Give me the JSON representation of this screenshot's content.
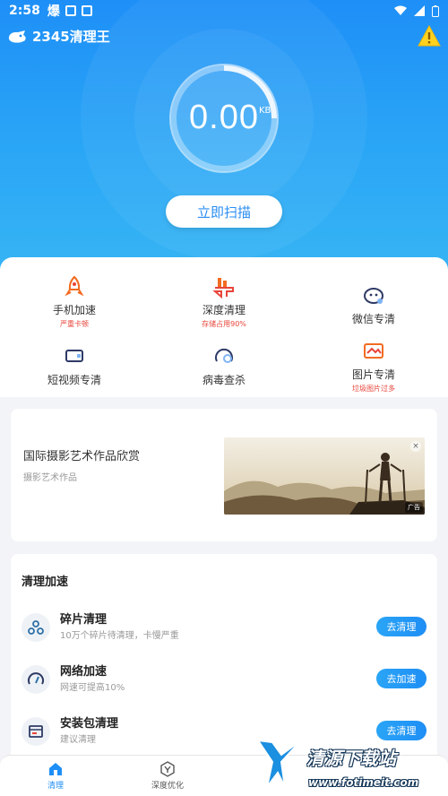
{
  "status_bar": {
    "time": "2:58",
    "carrier_glyph": "爆"
  },
  "app": {
    "title": "2345清理王"
  },
  "scanner": {
    "value": "0.00",
    "unit": "KB",
    "scan_button": "立即扫描"
  },
  "tools": [
    {
      "label": "手机加速",
      "sub": "严重卡顿",
      "icon": "rocket-icon"
    },
    {
      "label": "深度清理",
      "sub": "存储占用90%",
      "icon": "broom-icon"
    },
    {
      "label": "微信专清",
      "sub": "",
      "icon": "wechat-icon"
    },
    {
      "label": "短视频专清",
      "sub": "",
      "icon": "video-icon"
    },
    {
      "label": "病毒查杀",
      "sub": "",
      "icon": "virus-scan-icon"
    },
    {
      "label": "图片专清",
      "sub": "垃圾图片过多",
      "icon": "image-icon"
    }
  ],
  "ad": {
    "title": "国际摄影艺术作品欣赏",
    "subtitle": "摄影艺术作品",
    "close": "×",
    "tag": "广告"
  },
  "clean_section": {
    "heading": "清理加速",
    "rows": [
      {
        "title": "碎片清理",
        "desc": "10万个碎片待清理，卡慢严重",
        "button": "去清理",
        "icon": "fragment-icon"
      },
      {
        "title": "网络加速",
        "desc": "网速可提高10%",
        "button": "去加速",
        "icon": "speedometer-icon"
      },
      {
        "title": "安装包清理",
        "desc": "建议清理",
        "button": "去清理",
        "icon": "package-icon"
      }
    ]
  },
  "tabs": [
    {
      "label": "清理",
      "icon": "home-icon",
      "active": true
    },
    {
      "label": "深度优化",
      "icon": "optimize-icon",
      "active": false
    }
  ],
  "watermark": {
    "title": "清源下载站",
    "url": "www.fotimeit.com"
  },
  "colors": {
    "primary": "#1e8ff7",
    "accent_red": "#e8443a",
    "orange": "#f26b21"
  }
}
